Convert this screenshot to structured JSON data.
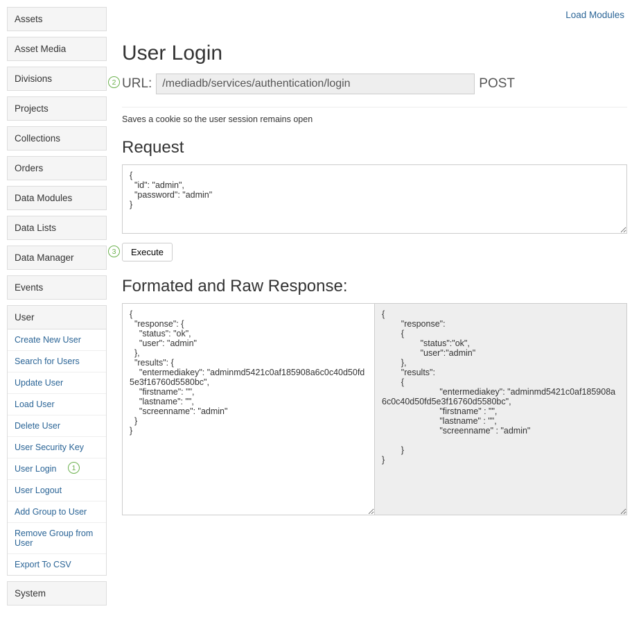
{
  "header": {
    "load_modules": "Load Modules"
  },
  "sidebar": {
    "sections": [
      "Assets",
      "Asset Media",
      "Divisions",
      "Projects",
      "Collections",
      "Orders",
      "Data Modules",
      "Data Lists",
      "Data Manager",
      "Events"
    ],
    "user_header": "User",
    "user_links": [
      "Create New User",
      "Search for Users",
      "Update User",
      "Load User",
      "Delete User",
      "User Security Key",
      "User Login",
      "User Logout",
      "Add Group to User",
      "Remove Group from User",
      "Export To CSV"
    ],
    "system_header": "System"
  },
  "page": {
    "title": "User Login",
    "url_label": "URL:",
    "url_value": "/mediadb/services/authentication/login",
    "method": "POST",
    "description": "Saves a cookie so the user session remains open",
    "request_heading": "Request",
    "request_body": "{\n  \"id\": \"admin\",\n  \"password\": \"admin\"\n}",
    "execute_label": "Execute",
    "response_heading": "Formated and Raw Response:",
    "response_formatted": "{\n  \"response\": {\n    \"status\": \"ok\",\n    \"user\": \"admin\"\n  },\n  \"results\": {\n    \"entermediakey\": \"adminmd5421c0af185908a6c0c40d50fd5e3f16760d5580bc\",\n    \"firstname\": \"\",\n    \"lastname\": \"\",\n    \"screenname\": \"admin\"\n  }\n}",
    "response_raw": "{\n        \"response\":\n        {\n                \"status\":\"ok\",\n                \"user\":\"admin\"\n        },\n        \"results\":\n        {\n                        \"entermediakey\": \"adminmd5421c0af185908a6c0c40d50fd5e3f16760d5580bc\",\n                        \"firstname\" : \"\",\n                        \"lastname\" : \"\",\n                        \"screenname\" : \"admin\"\n\n        }\n}"
  },
  "annotations": {
    "one": "1",
    "two": "2",
    "three": "3"
  }
}
